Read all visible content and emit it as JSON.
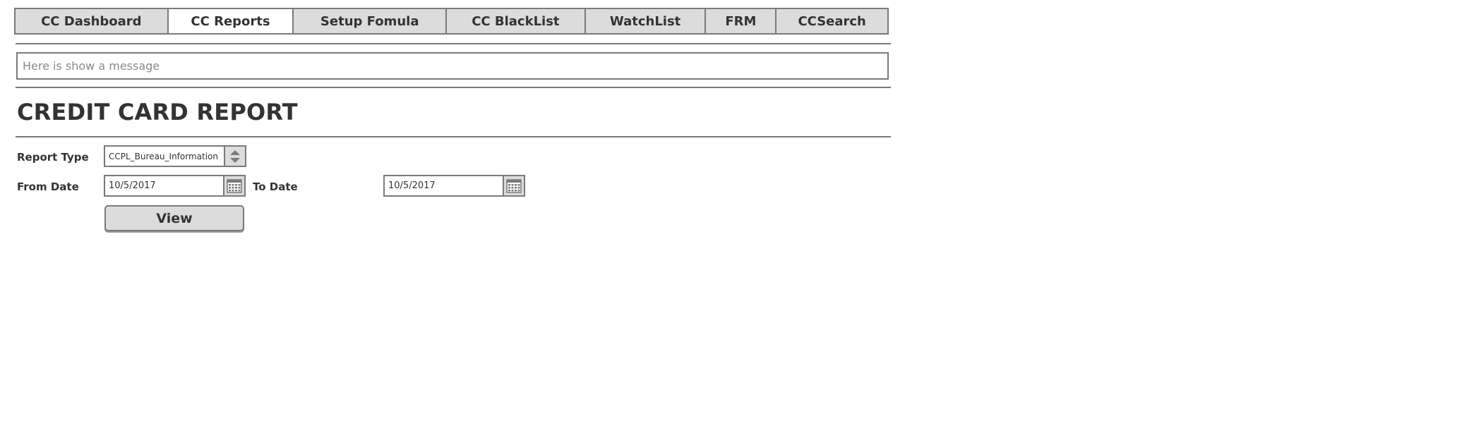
{
  "nav": {
    "tabs": [
      {
        "label": "CC Dashboard",
        "active": false
      },
      {
        "label": "CC Reports",
        "active": true
      },
      {
        "label": "Setup Fomula",
        "active": false
      },
      {
        "label": "CC BlackList",
        "active": false
      },
      {
        "label": "WatchList",
        "active": false
      },
      {
        "label": "FRM",
        "active": false
      },
      {
        "label": "CCSearch",
        "active": false
      }
    ]
  },
  "message": {
    "text": "Here is show a message"
  },
  "page": {
    "title": "CREDIT CARD REPORT"
  },
  "form": {
    "report_type": {
      "label": "Report Type",
      "value": "CCPL_Bureau_Information",
      "control_icon": "up-down-arrows-icon"
    },
    "from_date": {
      "label": "From Date",
      "value": "10/5/2017",
      "control_icon": "calendar-icon"
    },
    "to_date": {
      "label": "To Date",
      "value": "10/5/2017",
      "control_icon": "calendar-icon"
    },
    "view_button": {
      "label": "View"
    }
  },
  "colors": {
    "border": "#7a7a7a",
    "control_bg": "#dcdcdc",
    "text": "#333333",
    "placeholder_text": "#8a8a8a"
  }
}
